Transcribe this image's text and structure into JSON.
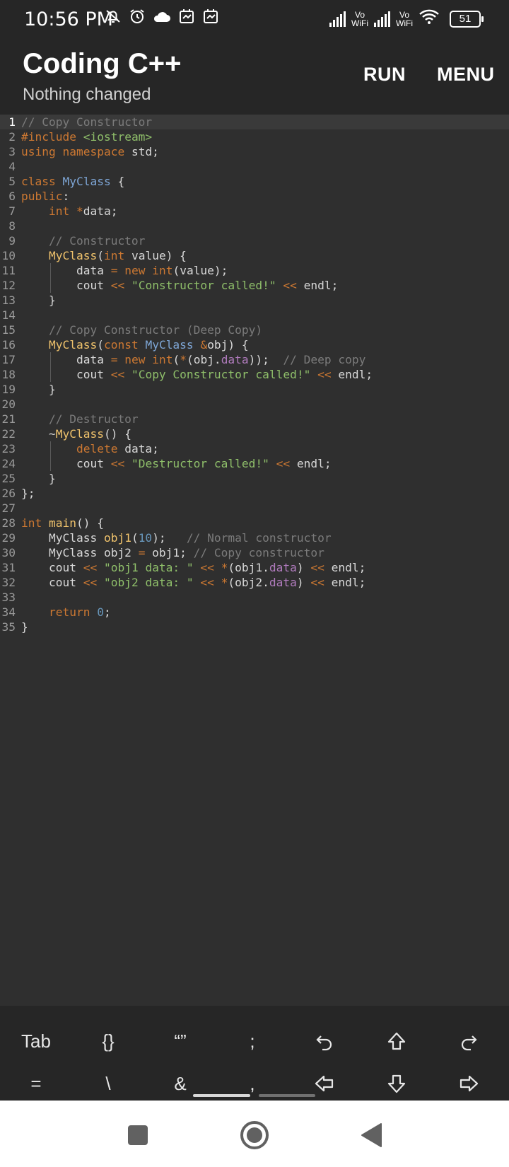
{
  "status_bar": {
    "time": "10:56 PM",
    "icons_left": [
      "mute-bell-icon",
      "alarm-icon",
      "cloud-icon",
      "app-notification-icon",
      "app-notification-icon"
    ],
    "vowifi_label_1": "Vo\nWiFi",
    "vowifi_label_2": "Vo\nWiFi",
    "battery": "51"
  },
  "app_bar": {
    "title": "Coding C++",
    "subtitle": "Nothing changed",
    "run_label": "RUN",
    "menu_label": "MENU"
  },
  "editor": {
    "current_line": 1,
    "line_numbers": [
      "1",
      "2",
      "3",
      "4",
      "5",
      "6",
      "7",
      "8",
      "9",
      "10",
      "11",
      "12",
      "13",
      "14",
      "15",
      "16",
      "17",
      "18",
      "19",
      "20",
      "21",
      "22",
      "23",
      "24",
      "25",
      "26",
      "27",
      "28",
      "29",
      "30",
      "31",
      "32",
      "33",
      "34",
      "35"
    ],
    "lines": [
      "// Copy Constructor",
      "#include <iostream>",
      "using namespace std;",
      "",
      "class MyClass {",
      "public:",
      "    int *data;",
      "",
      "    // Constructor",
      "    MyClass(int value) {",
      "        data = new int(value);",
      "        cout << \"Constructor called!\" << endl;",
      "    }",
      "",
      "    // Copy Constructor (Deep Copy)",
      "    MyClass(const MyClass &obj) {",
      "        data = new int(*(obj.data));  // Deep copy",
      "        cout << \"Copy Constructor called!\" << endl;",
      "    }",
      "",
      "    // Destructor",
      "    ~MyClass() {",
      "        delete data;",
      "        cout << \"Destructor called!\" << endl;",
      "    }",
      "};",
      "",
      "int main() {",
      "    MyClass obj1(10);   // Normal constructor",
      "    MyClass obj2 = obj1; // Copy constructor",
      "    cout << \"obj1 data: \" << *(obj1.data) << endl;",
      "    cout << \"obj2 data: \" << *(obj2.data) << endl;",
      "",
      "    return 0;",
      "}"
    ]
  },
  "extra_keys": {
    "row1": [
      "Tab",
      "{}",
      "“”",
      ";",
      "undo-icon",
      "shift-icon",
      "redo-icon"
    ],
    "row2": [
      "=",
      "\\",
      "&",
      ",",
      "arrow-left-icon",
      "arrow-down-icon",
      "arrow-right-icon"
    ]
  },
  "nav_bar": {
    "buttons": [
      "recents-icon",
      "home-icon",
      "back-icon"
    ]
  }
}
